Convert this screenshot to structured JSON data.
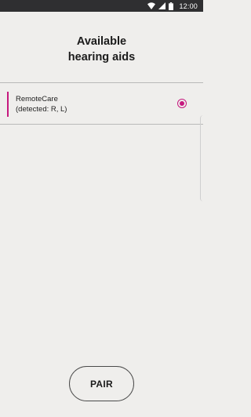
{
  "status_bar": {
    "time": "12:00",
    "icons": [
      "wifi-icon",
      "cell-signal-icon",
      "battery-icon"
    ],
    "background": "#2f2f31"
  },
  "header": {
    "title_line1": "Available",
    "title_line2": "hearing aids"
  },
  "devices": [
    {
      "name": "RemoteCare",
      "detail": "(detected: R, L)",
      "selected": true
    }
  ],
  "actions": {
    "pair_label": "PAIR"
  },
  "colors": {
    "accent": "#c6187e",
    "background": "#efeeec",
    "divider": "#b9b9b9"
  }
}
